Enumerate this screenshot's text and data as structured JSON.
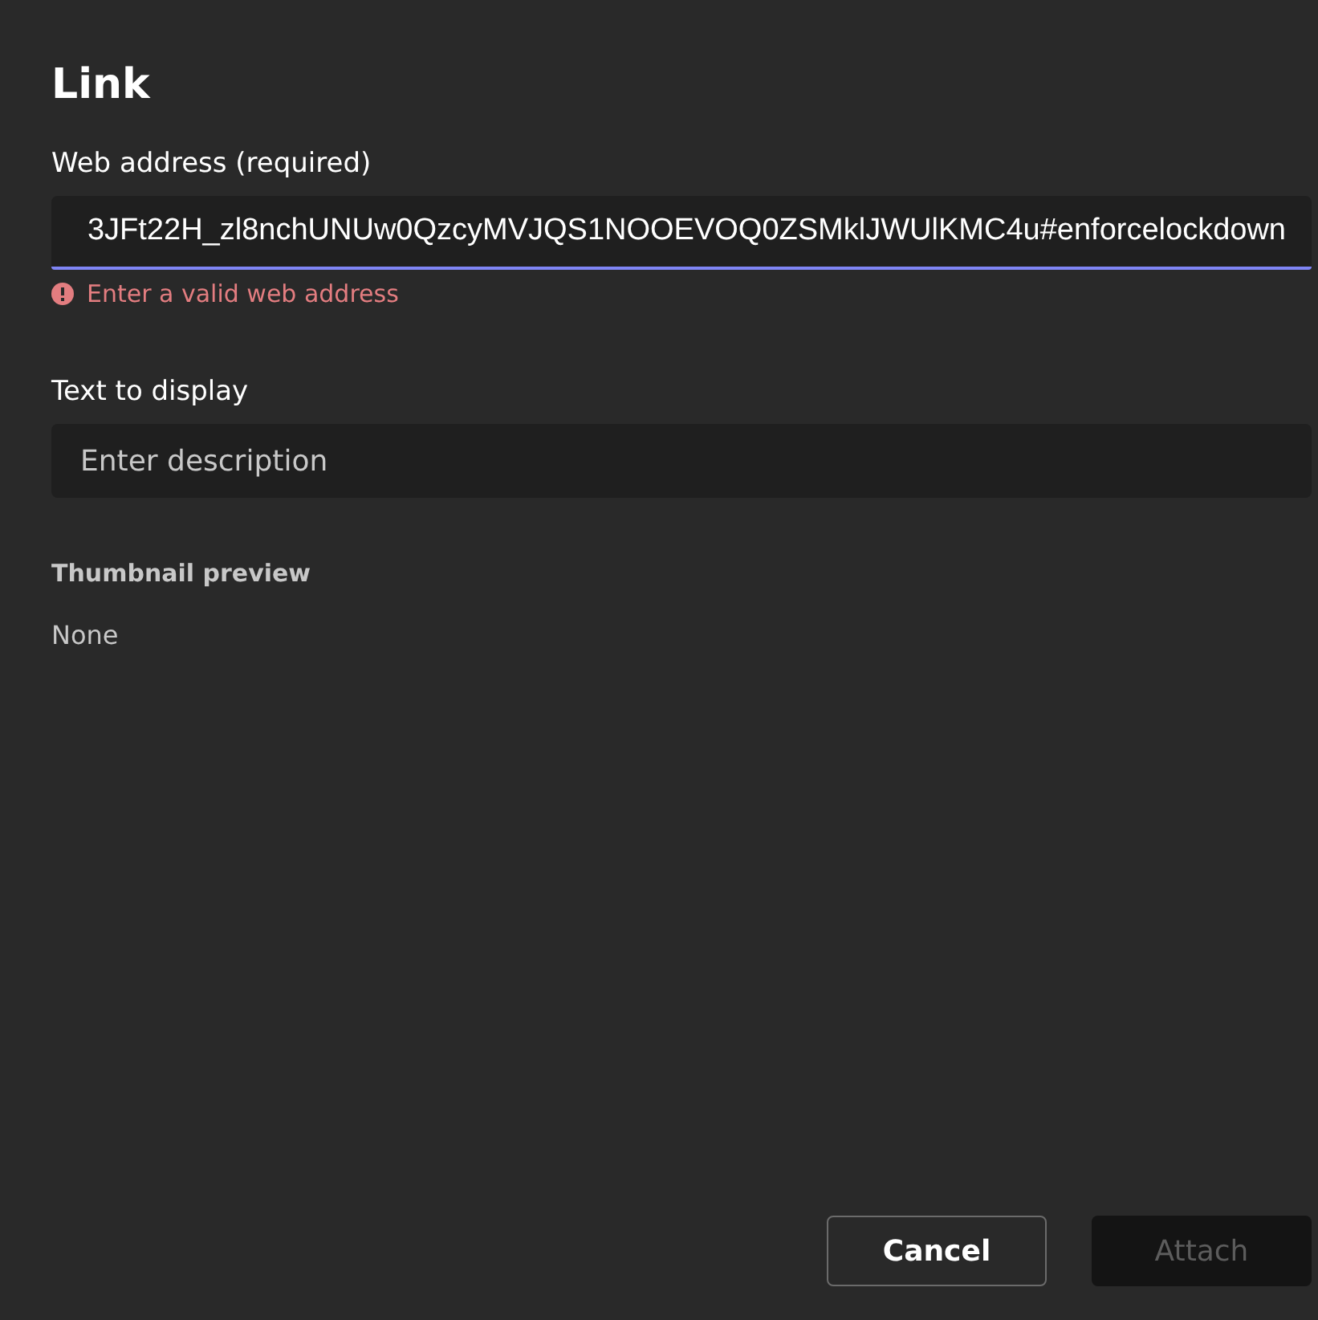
{
  "dialog": {
    "title": "Link"
  },
  "url_field": {
    "label": "Web address (required)",
    "value": "3JFt22H_zl8nchUNUw0QzcyMVJQS1NOOEVOQ0ZSMklJWUlKMC4u#enforcelockdown",
    "focused": true,
    "error": "Enter a valid web address"
  },
  "text_field": {
    "label": "Text to display",
    "placeholder": "Enter description"
  },
  "thumbnail": {
    "label": "Thumbnail preview",
    "value": "None"
  },
  "buttons": [
    {
      "label": "Cancel",
      "kind": "secondary",
      "disabled": false
    },
    {
      "label": "Attach",
      "kind": "primary",
      "disabled": true
    }
  ]
}
